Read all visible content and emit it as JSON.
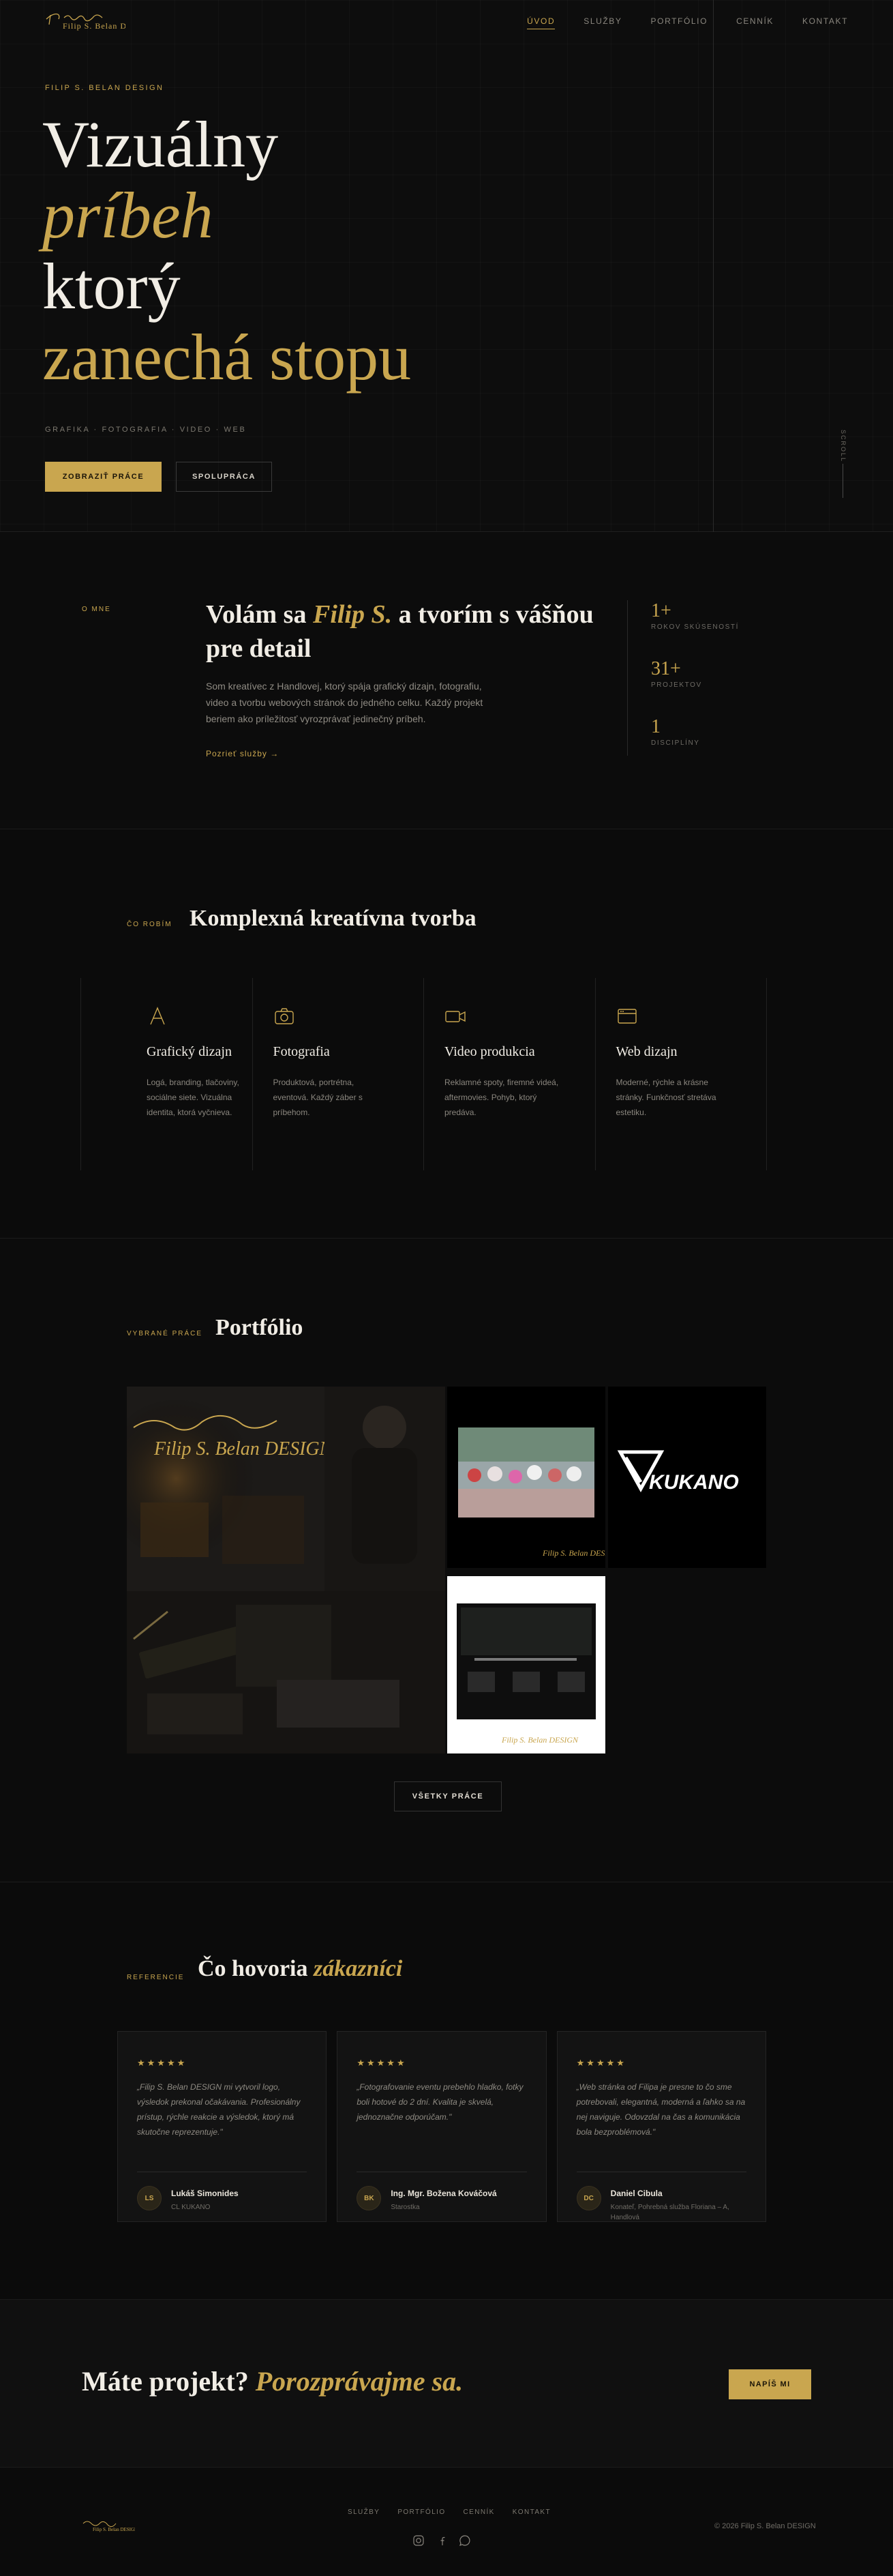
{
  "nav": {
    "logo_text": "Filip S. Belan DESIGN",
    "links": [
      {
        "label": "ÚVOD",
        "active": true
      },
      {
        "label": "SLUŽBY",
        "active": false
      },
      {
        "label": "PORTFÓLIO",
        "active": false
      },
      {
        "label": "CENNÍK",
        "active": false
      },
      {
        "label": "KONTAKT",
        "active": false
      }
    ]
  },
  "hero": {
    "eyebrow": "FILIP S. BELAN DESIGN",
    "line1": "Vizuálny",
    "line2": "príbeh",
    "line3": "ktorý",
    "line4": "zanechá stopu",
    "subtitle": "GRAFIKA · FOTOGRAFIA · VIDEO · WEB",
    "primary_button": "ZOBRAZIŤ PRÁCE",
    "secondary_button": "SPOLUPRÁCA",
    "scroll_label": "SCROLL"
  },
  "about": {
    "label": "O MNE",
    "title_pre": "Volám sa ",
    "title_name": "Filip S.",
    "title_post": " a tvorím s vášňou pre detail",
    "text": "Som kreatívec z Handlovej, ktorý spája grafický dizajn, fotografiu, video a tvorbu webových stránok do jedného celku. Každý projekt beriem ako príležitosť vyrozprávať jedinečný príbeh.",
    "link": "Pozrieť služby →",
    "stats": [
      {
        "value": "1+",
        "label": "ROKOV SKÚSENOSTÍ"
      },
      {
        "value": "31+",
        "label": "PROJEKTOV"
      },
      {
        "value": "1",
        "label": "DISCIPLÍNY"
      }
    ]
  },
  "services": {
    "label": "ČO ROBÍM",
    "title": "Komplexná kreatívna tvorba",
    "items": [
      {
        "icon": "triangle-icon",
        "name": "Grafický dizajn",
        "desc": "Logá, branding, tlačoviny, sociálne siete. Vizuálna identita, ktorá vyčnieva."
      },
      {
        "icon": "camera-icon",
        "name": "Fotografia",
        "desc": "Produktová, portrétna, eventová. Každý záber s príbehom."
      },
      {
        "icon": "video-camera-icon",
        "name": "Video produkcia",
        "desc": "Reklamné spoty, firemné videá, aftermovies. Pohyb, ktorý predáva."
      },
      {
        "icon": "browser-window-icon",
        "name": "Web dizajn",
        "desc": "Moderné, rýchle a krásne stránky. Funkčnosť stretáva estetiku."
      }
    ]
  },
  "portfolio": {
    "label": "VYBRANÉ PRÁCE",
    "title": "Portfólio",
    "tiles": [
      {
        "name": "portfolio-item-branding-facade",
        "logo_text": "Filip S. Belan DESIGN"
      },
      {
        "name": "portfolio-item-event-photo",
        "logo_text": "Filip S. Belan DESIGN"
      },
      {
        "name": "portfolio-item-kukano-logo",
        "logo_text": "KUKANO"
      },
      {
        "name": "portfolio-item-website",
        "logo_text": "Filip S. Belan DESIGN"
      }
    ],
    "button": "VŠETKY PRÁCE"
  },
  "testimonials": {
    "label": "REFERENCIE",
    "title_pre": "Čo hovoria ",
    "title_it": "zákazníci",
    "items": [
      {
        "stars": "★★★★★",
        "quote": "„Filip S. Belan DESIGN mi vytvoril logo, výsledok prekonal očakávania. Profesionálny prístup, rýchle reakcie a výsledok, ktorý má skutočne reprezentuje.\"",
        "initials": "LS",
        "name": "Lukáš Simonides",
        "role": "CL KUKANO"
      },
      {
        "stars": "★★★★★",
        "quote": "„Fotografovanie eventu prebehlo hladko, fotky boli hotové do 2 dní. Kvalita je skvelá, jednoznačne odporúčam.\"",
        "initials": "BK",
        "name": "Ing. Mgr. Božena Kováčová",
        "role": "Starostka"
      },
      {
        "stars": "★★★★★",
        "quote": "„Web stránka od Filipa je presne to čo sme potrebovali, elegantná, moderná a ľahko sa na nej naviguje. Odovzdal na čas a komunikácia bola bezproblémová.\"",
        "initials": "DC",
        "name": "Daniel Cibula",
        "role": "Konateľ, Pohrebná služba Floriana – A, Handlová"
      }
    ]
  },
  "cta": {
    "title_pre": "Máte projekt? ",
    "title_it": "Porozprávajme sa.",
    "button": "NAPÍŠ MI"
  },
  "footer": {
    "logo_text": "Filip S. Belan DESIGN",
    "links": [
      "SLUŽBY",
      "PORTFÓLIO",
      "CENNÍK",
      "KONTAKT"
    ],
    "social": [
      "instagram-icon",
      "facebook-icon",
      "chat-icon"
    ],
    "copyright": "© 2026 Filip S. Belan DESIGN"
  },
  "colors": {
    "accent": "#c9a64f",
    "background": "#0c0c0c",
    "text": "#f1ede5"
  }
}
